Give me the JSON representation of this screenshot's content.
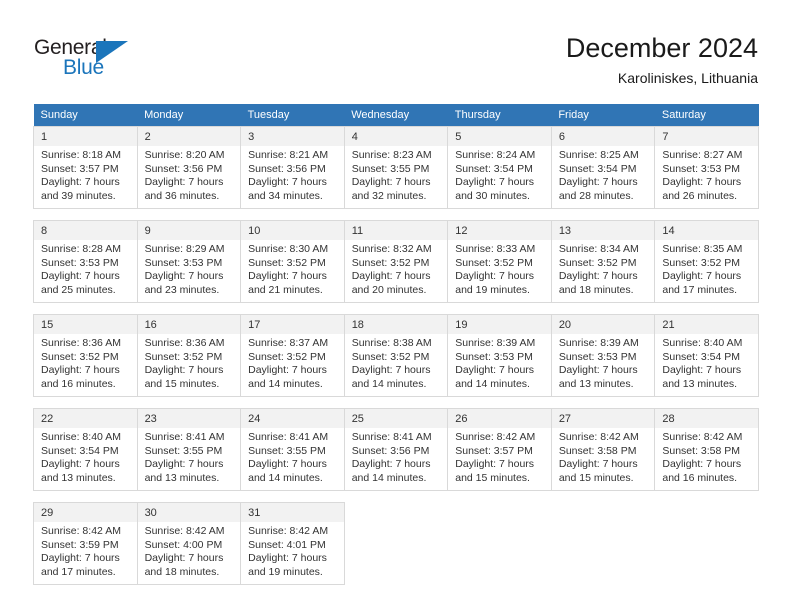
{
  "logo": {
    "word_one": "General",
    "word_two": "Blue",
    "triangle_icon": "triangle-icon",
    "accent_color": "#1b75bb"
  },
  "header": {
    "title": "December 2024",
    "location": "Karoliniskes, Lithuania"
  },
  "calendar": {
    "header_bg": "#3075b5",
    "daynum_bg": "#f2f2f2",
    "weekday_headers": [
      "Sunday",
      "Monday",
      "Tuesday",
      "Wednesday",
      "Thursday",
      "Friday",
      "Saturday"
    ],
    "weeks": [
      [
        {
          "day": "1",
          "sunrise": "Sunrise: 8:18 AM",
          "sunset": "Sunset: 3:57 PM",
          "daylight_1": "Daylight: 7 hours",
          "daylight_2": "and 39 minutes."
        },
        {
          "day": "2",
          "sunrise": "Sunrise: 8:20 AM",
          "sunset": "Sunset: 3:56 PM",
          "daylight_1": "Daylight: 7 hours",
          "daylight_2": "and 36 minutes."
        },
        {
          "day": "3",
          "sunrise": "Sunrise: 8:21 AM",
          "sunset": "Sunset: 3:56 PM",
          "daylight_1": "Daylight: 7 hours",
          "daylight_2": "and 34 minutes."
        },
        {
          "day": "4",
          "sunrise": "Sunrise: 8:23 AM",
          "sunset": "Sunset: 3:55 PM",
          "daylight_1": "Daylight: 7 hours",
          "daylight_2": "and 32 minutes."
        },
        {
          "day": "5",
          "sunrise": "Sunrise: 8:24 AM",
          "sunset": "Sunset: 3:54 PM",
          "daylight_1": "Daylight: 7 hours",
          "daylight_2": "and 30 minutes."
        },
        {
          "day": "6",
          "sunrise": "Sunrise: 8:25 AM",
          "sunset": "Sunset: 3:54 PM",
          "daylight_1": "Daylight: 7 hours",
          "daylight_2": "and 28 minutes."
        },
        {
          "day": "7",
          "sunrise": "Sunrise: 8:27 AM",
          "sunset": "Sunset: 3:53 PM",
          "daylight_1": "Daylight: 7 hours",
          "daylight_2": "and 26 minutes."
        }
      ],
      [
        {
          "day": "8",
          "sunrise": "Sunrise: 8:28 AM",
          "sunset": "Sunset: 3:53 PM",
          "daylight_1": "Daylight: 7 hours",
          "daylight_2": "and 25 minutes."
        },
        {
          "day": "9",
          "sunrise": "Sunrise: 8:29 AM",
          "sunset": "Sunset: 3:53 PM",
          "daylight_1": "Daylight: 7 hours",
          "daylight_2": "and 23 minutes."
        },
        {
          "day": "10",
          "sunrise": "Sunrise: 8:30 AM",
          "sunset": "Sunset: 3:52 PM",
          "daylight_1": "Daylight: 7 hours",
          "daylight_2": "and 21 minutes."
        },
        {
          "day": "11",
          "sunrise": "Sunrise: 8:32 AM",
          "sunset": "Sunset: 3:52 PM",
          "daylight_1": "Daylight: 7 hours",
          "daylight_2": "and 20 minutes."
        },
        {
          "day": "12",
          "sunrise": "Sunrise: 8:33 AM",
          "sunset": "Sunset: 3:52 PM",
          "daylight_1": "Daylight: 7 hours",
          "daylight_2": "and 19 minutes."
        },
        {
          "day": "13",
          "sunrise": "Sunrise: 8:34 AM",
          "sunset": "Sunset: 3:52 PM",
          "daylight_1": "Daylight: 7 hours",
          "daylight_2": "and 18 minutes."
        },
        {
          "day": "14",
          "sunrise": "Sunrise: 8:35 AM",
          "sunset": "Sunset: 3:52 PM",
          "daylight_1": "Daylight: 7 hours",
          "daylight_2": "and 17 minutes."
        }
      ],
      [
        {
          "day": "15",
          "sunrise": "Sunrise: 8:36 AM",
          "sunset": "Sunset: 3:52 PM",
          "daylight_1": "Daylight: 7 hours",
          "daylight_2": "and 16 minutes."
        },
        {
          "day": "16",
          "sunrise": "Sunrise: 8:36 AM",
          "sunset": "Sunset: 3:52 PM",
          "daylight_1": "Daylight: 7 hours",
          "daylight_2": "and 15 minutes."
        },
        {
          "day": "17",
          "sunrise": "Sunrise: 8:37 AM",
          "sunset": "Sunset: 3:52 PM",
          "daylight_1": "Daylight: 7 hours",
          "daylight_2": "and 14 minutes."
        },
        {
          "day": "18",
          "sunrise": "Sunrise: 8:38 AM",
          "sunset": "Sunset: 3:52 PM",
          "daylight_1": "Daylight: 7 hours",
          "daylight_2": "and 14 minutes."
        },
        {
          "day": "19",
          "sunrise": "Sunrise: 8:39 AM",
          "sunset": "Sunset: 3:53 PM",
          "daylight_1": "Daylight: 7 hours",
          "daylight_2": "and 14 minutes."
        },
        {
          "day": "20",
          "sunrise": "Sunrise: 8:39 AM",
          "sunset": "Sunset: 3:53 PM",
          "daylight_1": "Daylight: 7 hours",
          "daylight_2": "and 13 minutes."
        },
        {
          "day": "21",
          "sunrise": "Sunrise: 8:40 AM",
          "sunset": "Sunset: 3:54 PM",
          "daylight_1": "Daylight: 7 hours",
          "daylight_2": "and 13 minutes."
        }
      ],
      [
        {
          "day": "22",
          "sunrise": "Sunrise: 8:40 AM",
          "sunset": "Sunset: 3:54 PM",
          "daylight_1": "Daylight: 7 hours",
          "daylight_2": "and 13 minutes."
        },
        {
          "day": "23",
          "sunrise": "Sunrise: 8:41 AM",
          "sunset": "Sunset: 3:55 PM",
          "daylight_1": "Daylight: 7 hours",
          "daylight_2": "and 13 minutes."
        },
        {
          "day": "24",
          "sunrise": "Sunrise: 8:41 AM",
          "sunset": "Sunset: 3:55 PM",
          "daylight_1": "Daylight: 7 hours",
          "daylight_2": "and 14 minutes."
        },
        {
          "day": "25",
          "sunrise": "Sunrise: 8:41 AM",
          "sunset": "Sunset: 3:56 PM",
          "daylight_1": "Daylight: 7 hours",
          "daylight_2": "and 14 minutes."
        },
        {
          "day": "26",
          "sunrise": "Sunrise: 8:42 AM",
          "sunset": "Sunset: 3:57 PM",
          "daylight_1": "Daylight: 7 hours",
          "daylight_2": "and 15 minutes."
        },
        {
          "day": "27",
          "sunrise": "Sunrise: 8:42 AM",
          "sunset": "Sunset: 3:58 PM",
          "daylight_1": "Daylight: 7 hours",
          "daylight_2": "and 15 minutes."
        },
        {
          "day": "28",
          "sunrise": "Sunrise: 8:42 AM",
          "sunset": "Sunset: 3:58 PM",
          "daylight_1": "Daylight: 7 hours",
          "daylight_2": "and 16 minutes."
        }
      ],
      [
        {
          "day": "29",
          "sunrise": "Sunrise: 8:42 AM",
          "sunset": "Sunset: 3:59 PM",
          "daylight_1": "Daylight: 7 hours",
          "daylight_2": "and 17 minutes."
        },
        {
          "day": "30",
          "sunrise": "Sunrise: 8:42 AM",
          "sunset": "Sunset: 4:00 PM",
          "daylight_1": "Daylight: 7 hours",
          "daylight_2": "and 18 minutes."
        },
        {
          "day": "31",
          "sunrise": "Sunrise: 8:42 AM",
          "sunset": "Sunset: 4:01 PM",
          "daylight_1": "Daylight: 7 hours",
          "daylight_2": "and 19 minutes."
        },
        {
          "day": "",
          "sunrise": "",
          "sunset": "",
          "daylight_1": "",
          "daylight_2": ""
        },
        {
          "day": "",
          "sunrise": "",
          "sunset": "",
          "daylight_1": "",
          "daylight_2": ""
        },
        {
          "day": "",
          "sunrise": "",
          "sunset": "",
          "daylight_1": "",
          "daylight_2": ""
        },
        {
          "day": "",
          "sunrise": "",
          "sunset": "",
          "daylight_1": "",
          "daylight_2": ""
        }
      ]
    ]
  }
}
